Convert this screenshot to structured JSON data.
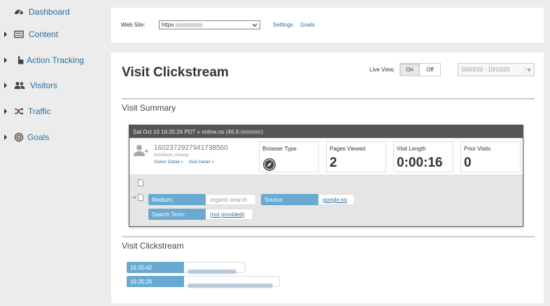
{
  "sidebar": {
    "items": [
      {
        "label": "Dashboard",
        "icon": "dashboard-icon",
        "has_caret": false
      },
      {
        "label": "Content",
        "icon": "list-icon",
        "has_caret": true
      },
      {
        "label": "Action Tracking",
        "icon": "pointer-hand-icon",
        "has_caret": true
      },
      {
        "label": "Visitors",
        "icon": "users-icon",
        "has_caret": true
      },
      {
        "label": "Traffic",
        "icon": "shuffle-icon",
        "has_caret": true
      },
      {
        "label": "Goals",
        "icon": "target-icon",
        "has_caret": true
      }
    ]
  },
  "top": {
    "website_label": "Web Site:",
    "website_value": "https",
    "settings_link": "Settings",
    "goals_link": "Goals"
  },
  "main": {
    "title": "Visit Clickstream",
    "live_view_label": "Live View:",
    "live_on": "On",
    "live_off": "Off",
    "date_range": "10/03/20 - 10/10/20",
    "summary_title": "Visit Summary",
    "clickstream_title": "Visit Clickstream"
  },
  "session": {
    "header": "Sat Oct 10 16:35:26 PDT » online.no (46.9.",
    "visitor_id": "1602372927941738560",
    "visitor_location": "trondheim, norway",
    "visitor_detail_link": "Visitor Detail »",
    "visit_detail_link": "Visit Detail »",
    "stats": [
      {
        "label": "Browser Type",
        "value": ""
      },
      {
        "label": "Pages Viewed",
        "value": "2"
      },
      {
        "label": "Visit Length",
        "value": "0:00:16"
      },
      {
        "label": "Prior Visits",
        "value": "0"
      }
    ],
    "medium_label": "Medium:",
    "medium_value": "organic-search",
    "source_label": "Source:",
    "source_value": "google.no",
    "search_term_label": "Search Term:",
    "search_term_value": "(not provided)"
  },
  "clickstream": [
    {
      "time": "16:35:42"
    },
    {
      "time": "16:35:26"
    }
  ],
  "colors": {
    "accent_blue": "#6aaad2",
    "link_blue": "#2a6fa0",
    "session_header": "#555555"
  }
}
